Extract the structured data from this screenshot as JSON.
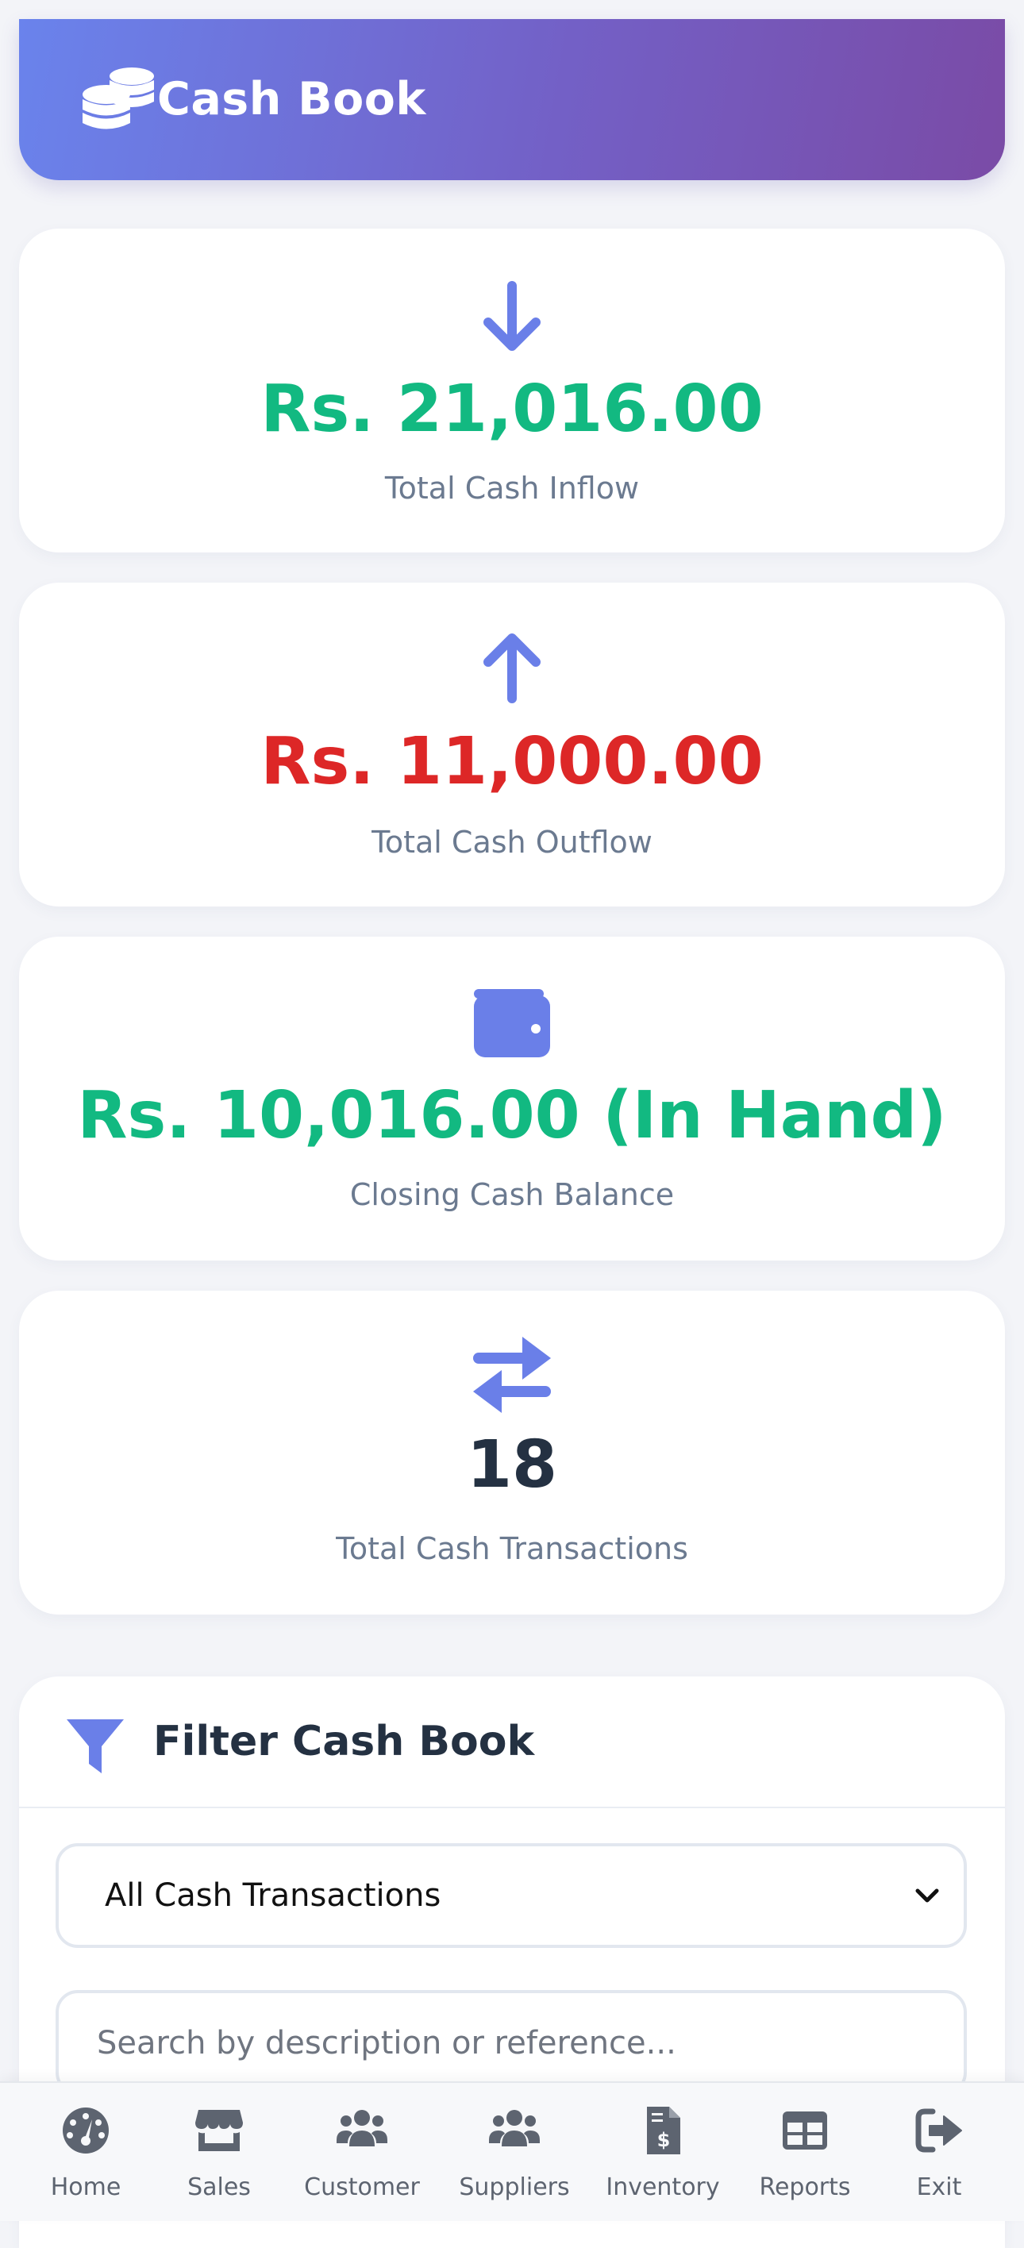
{
  "header": {
    "title": "Cash Book",
    "icon": "coins-icon"
  },
  "summary": [
    {
      "value": "Rs. 21,016.00",
      "label": "Total Cash Inflow",
      "icon": "arrow-down-icon",
      "color": "#12b981"
    },
    {
      "value": "Rs. 11,000.00",
      "label": "Total Cash Outflow",
      "icon": "arrow-up-icon",
      "color": "#dd2727"
    },
    {
      "value": "Rs. 10,016.00 (In Hand)",
      "label": "Closing Cash Balance",
      "icon": "wallet-icon",
      "color": "#12b981"
    },
    {
      "value": "18",
      "label": "Total Cash Transactions",
      "icon": "exchange-icon",
      "color": "#243142"
    }
  ],
  "filter": {
    "title": "Filter Cash Book",
    "icon": "filter-icon",
    "select_value": "All Cash Transactions",
    "search_placeholder": "Search by description or reference..."
  },
  "nav": [
    {
      "label": "Home",
      "icon": "dashboard-icon"
    },
    {
      "label": "Sales",
      "icon": "store-icon"
    },
    {
      "label": "Customer",
      "icon": "users-icon"
    },
    {
      "label": "Suppliers",
      "icon": "users-icon"
    },
    {
      "label": "Inventory",
      "icon": "invoice-dollar-icon"
    },
    {
      "label": "Reports",
      "icon": "table-icon"
    },
    {
      "label": "Exit",
      "icon": "sign-out-icon"
    }
  ],
  "colors": {
    "accent": "#6a7fe8",
    "header_gradient_start": "#6a83ec",
    "header_gradient_end": "#7a4ba6",
    "nav_icon": "#5d6470"
  }
}
